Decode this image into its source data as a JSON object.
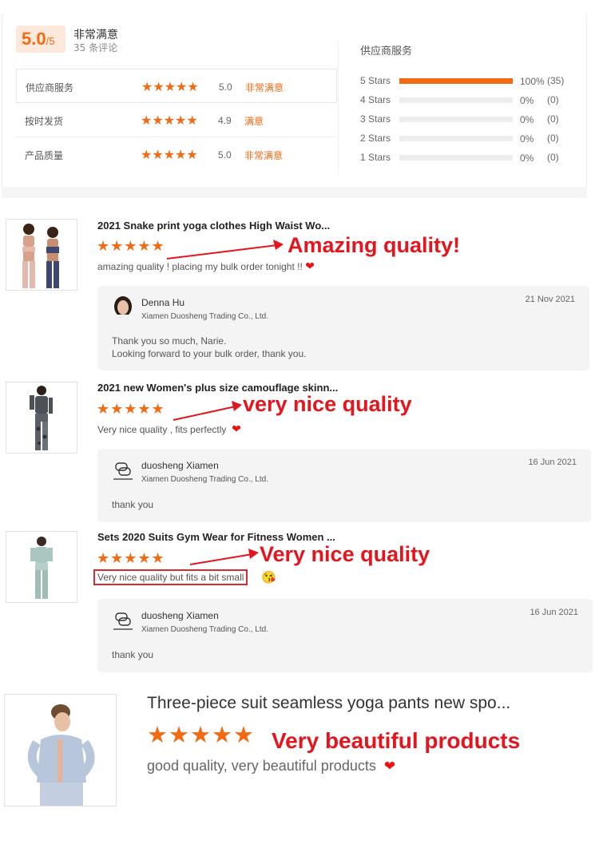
{
  "summary": {
    "score": "5.0",
    "score_out_of": "/5",
    "title": "非常满意",
    "review_count": "35 条评论",
    "ratings": [
      {
        "label": "供应商服务",
        "stars": "★★★★★",
        "value": "5.0",
        "word": "非常满意"
      },
      {
        "label": "按时发货",
        "stars": "★★★★★",
        "value": "4.9",
        "word": "满意"
      },
      {
        "label": "产品质量",
        "stars": "★★★★★",
        "value": "5.0",
        "word": "非常满意"
      }
    ],
    "distribution_title": "供应商服务",
    "distribution": [
      {
        "label": "5 Stars",
        "fraction": 1.0,
        "percent": "100%",
        "count": "(35)"
      },
      {
        "label": "4 Stars",
        "fraction": 0,
        "percent": "0%",
        "count": "(0)"
      },
      {
        "label": "3 Stars",
        "fraction": 0,
        "percent": "0%",
        "count": "(0)"
      },
      {
        "label": "2 Stars",
        "fraction": 0,
        "percent": "0%",
        "count": "(0)"
      },
      {
        "label": "1 Stars",
        "fraction": 0,
        "percent": "0%",
        "count": "(0)"
      }
    ],
    "colors": {
      "accent": "#f26b14",
      "badge_bg": "#fde9dc"
    }
  },
  "reviews": [
    {
      "title": "2021 Snake print yoga clothes High Waist Wo...",
      "stars": "★★★★★",
      "text": "amazing quality ! placing my bulk order tonight !!",
      "callout": "Amazing quality!",
      "reply": {
        "name": "Denna Hu",
        "company": "Xiamen Duosheng Trading Co., Ltd.",
        "date": "21 Nov 2021",
        "message_line1": "Thank you so much, Narie.",
        "message_line2": "Looking forward to your bulk order, thank you."
      }
    },
    {
      "title": "2021 new Women's plus size camouflage skinn...",
      "stars": "★★★★★",
      "text": "Very nice quality , fits perfectly",
      "callout": "very nice quality",
      "reply": {
        "name": "duosheng Xiamen",
        "company": "Xiamen Duosheng Trading Co., Ltd.",
        "date": "16 Jun 2021",
        "message_line1": "thank you"
      }
    },
    {
      "title": "Sets 2020 Suits Gym Wear for Fitness Women ...",
      "stars": "★★★★★",
      "text": "Very nice quality but fits a bit small",
      "callout": "Very nice quality",
      "reply": {
        "name": "duosheng Xiamen",
        "company": "Xiamen Duosheng Trading Co., Ltd.",
        "date": "16 Jun 2021",
        "message_line1": "thank you"
      }
    },
    {
      "title": "Three-piece suit seamless yoga pants new spo...",
      "stars": "★★★★★",
      "text": "good quality, very beautiful products",
      "callout": "Very beautiful products"
    }
  ],
  "icons": {
    "heart": "heart-icon",
    "star": "star-icon",
    "emoji": "wink-emoji-icon",
    "logo": "duosheng-logo-icon"
  }
}
